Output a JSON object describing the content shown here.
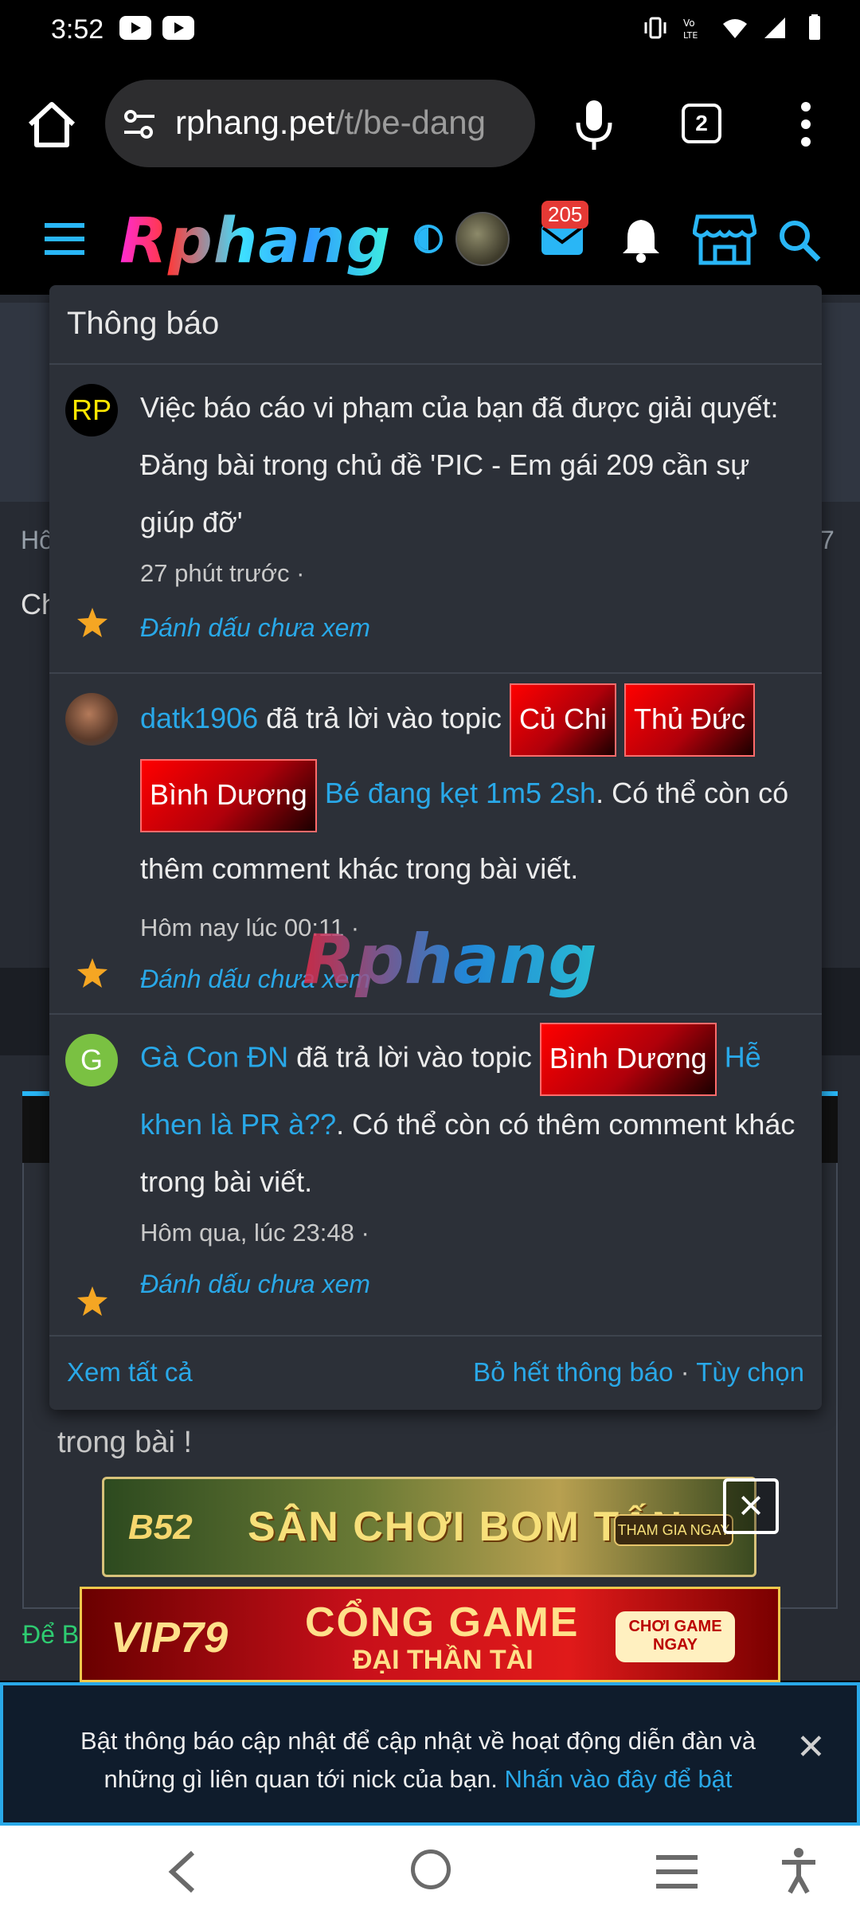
{
  "status_bar": {
    "time": "3:52"
  },
  "browser": {
    "url_host": "rphang.pet",
    "url_path": "/t/be-dang",
    "tab_count": "2"
  },
  "site": {
    "logo_text": "Rphang",
    "mail_badge": "205"
  },
  "background_page": {
    "left_fragment_1": "Hô",
    "left_fragment_2": "Ch",
    "right_fragment_1": "7",
    "text_line": "trong bài !",
    "green_fragment": "Để B"
  },
  "ads": {
    "ad1_brand": "B52",
    "ad1_title": "SÂN CHƠI BOM TẤN",
    "ad1_cta": "THAM GIA NGAY",
    "ad2_brand": "VIP79",
    "ad2_title": "CỔNG GAME",
    "ad2_sub": "ĐẠI THẦN TÀI",
    "ad2_cta": "CHƠI GAME NGAY"
  },
  "notifications": {
    "title": "Thông báo",
    "items": [
      {
        "avatar": "RP",
        "text": "Việc báo cáo vi phạm của bạn đã được giải quyết: Đăng bài trong chủ đề 'PIC - Em gái 209 cần sự giúp đỡ'",
        "time": "27 phút trước",
        "mark": "Đánh dấu chưa xem"
      },
      {
        "user": "datk1906",
        "action": "đã trả lời vào topic",
        "tags": [
          "Củ Chi",
          "Thủ Đức",
          "Bình Dương"
        ],
        "topic": "Bé đang kẹt 1m5 2sh",
        "tail": ". Có thể còn có thêm comment khác trong bài viết.",
        "time": "Hôm nay lúc 00:11",
        "mark": "Đánh dấu chưa xem"
      },
      {
        "avatar": "G",
        "user": "Gà Con ĐN",
        "action": "đã trả lời vào topic",
        "tags": [
          "Bình Dương"
        ],
        "topic": "Hễ khen là PR à??",
        "tail": ". Có thể còn có thêm comment khác trong bài viết.",
        "time": "Hôm qua, lúc 23:48",
        "mark": "Đánh dấu chưa xem"
      }
    ],
    "footer_view_all": "Xem tất cả",
    "footer_dismiss": "Bỏ hết thông báo",
    "footer_options": "Tùy chọn"
  },
  "watermark": "Rphang",
  "push_banner": {
    "text": "Bật thông báo cập nhật để cập nhật về hoạt động diễn đàn và những gì liên quan tới nick của bạn.",
    "link": "Nhấn vào đây để bật"
  }
}
